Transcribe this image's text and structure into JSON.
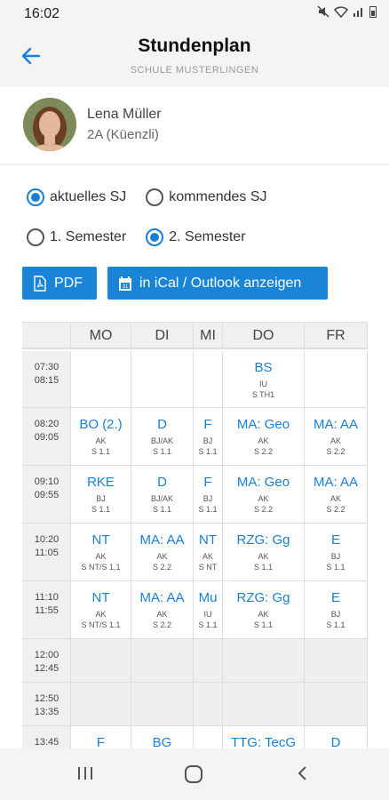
{
  "status": {
    "time": "16:02"
  },
  "header": {
    "title": "Stundenplan",
    "subtitle": "SCHULE MUSTERLINGEN"
  },
  "profile": {
    "name": "Lena Müller",
    "class": "2A (Küenzli)"
  },
  "filters": {
    "year": [
      {
        "label": "aktuelles SJ",
        "checked": true
      },
      {
        "label": "kommendes SJ",
        "checked": false
      }
    ],
    "semester": [
      {
        "label": "1. Semester",
        "checked": false
      },
      {
        "label": "2. Semester",
        "checked": true
      }
    ]
  },
  "buttons": {
    "pdf": "PDF",
    "ical": "in iCal / Outlook anzeigen"
  },
  "timetable": {
    "days": [
      "MO",
      "DI",
      "MI",
      "DO",
      "FR"
    ],
    "rows": [
      {
        "start": "07:30",
        "end": "08:15",
        "cells": [
          null,
          null,
          null,
          {
            "subject": "BS",
            "teacher": "IU",
            "room": "S TH1"
          },
          null
        ]
      },
      {
        "start": "08:20",
        "end": "09:05",
        "cells": [
          {
            "subject": "BO (2.)",
            "teacher": "AK",
            "room": "S 1.1"
          },
          {
            "subject": "D",
            "teacher": "BJ/AK",
            "room": "S 1.1"
          },
          {
            "subject": "F",
            "teacher": "BJ",
            "room": "S 1.1"
          },
          {
            "subject": "MA: Geo",
            "teacher": "AK",
            "room": "S 2.2"
          },
          {
            "subject": "MA: AA",
            "teacher": "AK",
            "room": "S 2.2"
          }
        ]
      },
      {
        "start": "09:10",
        "end": "09:55",
        "cells": [
          {
            "subject": "RKE",
            "teacher": "BJ",
            "room": "S 1.1"
          },
          {
            "subject": "D",
            "teacher": "BJ/AK",
            "room": "S 1.1"
          },
          {
            "subject": "F",
            "teacher": "BJ",
            "room": "S 1.1"
          },
          {
            "subject": "MA: Geo",
            "teacher": "AK",
            "room": "S 2.2"
          },
          {
            "subject": "MA: AA",
            "teacher": "AK",
            "room": "S 2.2"
          }
        ]
      },
      {
        "start": "10:20",
        "end": "11:05",
        "cells": [
          {
            "subject": "NT",
            "teacher": "AK",
            "room": "S NT/S 1.1"
          },
          {
            "subject": "MA: AA",
            "teacher": "AK",
            "room": "S 2.2"
          },
          {
            "subject": "NT",
            "teacher": "AK",
            "room": "S NT"
          },
          {
            "subject": "RZG: Gg",
            "teacher": "AK",
            "room": "S 1.1"
          },
          {
            "subject": "E",
            "teacher": "BJ",
            "room": "S 1.1"
          }
        ]
      },
      {
        "start": "11:10",
        "end": "11:55",
        "cells": [
          {
            "subject": "NT",
            "teacher": "AK",
            "room": "S NT/S 1.1"
          },
          {
            "subject": "MA: AA",
            "teacher": "AK",
            "room": "S 2.2"
          },
          {
            "subject": "Mu",
            "teacher": "IU",
            "room": "S 1.1"
          },
          {
            "subject": "RZG: Gg",
            "teacher": "AK",
            "room": "S 1.1"
          },
          {
            "subject": "E",
            "teacher": "BJ",
            "room": "S 1.1"
          }
        ]
      },
      {
        "start": "12:00",
        "end": "12:45",
        "gray": true,
        "cells": [
          null,
          null,
          null,
          null,
          null
        ]
      },
      {
        "start": "12:50",
        "end": "13:35",
        "gray": true,
        "cells": [
          null,
          null,
          null,
          null,
          null
        ]
      },
      {
        "start": "13:45",
        "end": "",
        "cells": [
          {
            "subject": "F",
            "teacher": "",
            "room": ""
          },
          {
            "subject": "BG",
            "teacher": "",
            "room": ""
          },
          null,
          {
            "subject": "TTG: TecG",
            "teacher": "",
            "room": ""
          },
          {
            "subject": "D",
            "teacher": "",
            "room": ""
          }
        ]
      }
    ]
  },
  "colors": {
    "accent": "#1a85d6",
    "link": "#1a7fd4"
  },
  "icons": {
    "back": "arrow-left-icon",
    "pdf": "pdf-file-icon",
    "calendar": "calendar-icon"
  }
}
